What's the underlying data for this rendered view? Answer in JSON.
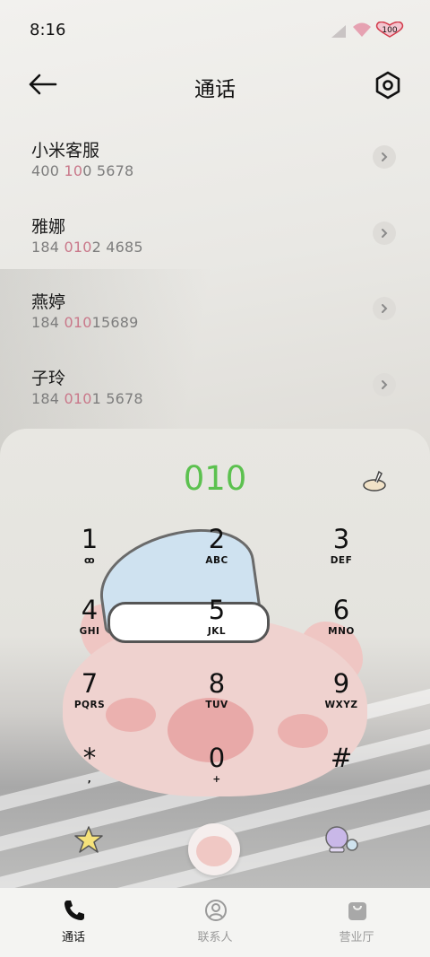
{
  "status_bar": {
    "time": "8:16",
    "battery": "100"
  },
  "header": {
    "title": "通话",
    "back_icon": "arrow-left-icon",
    "settings_icon": "settings-hexagon-icon"
  },
  "contacts": [
    {
      "name": "小米客服",
      "number_parts": [
        "400 ",
        "10",
        "0 5678"
      ]
    },
    {
      "name": "雅娜",
      "number_parts": [
        "184 ",
        "010",
        "2 4685"
      ]
    },
    {
      "name": "燕婷",
      "number_parts": [
        "184 ",
        "010",
        "15689"
      ]
    },
    {
      "name": "子玲",
      "number_parts": [
        "184 ",
        "010",
        "1 5678"
      ]
    }
  ],
  "dialer": {
    "input": "010",
    "keys": [
      {
        "digit": "1",
        "letters": "ꝏ"
      },
      {
        "digit": "2",
        "letters": "ABC"
      },
      {
        "digit": "3",
        "letters": "DEF"
      },
      {
        "digit": "4",
        "letters": "GHI"
      },
      {
        "digit": "5",
        "letters": "JKL"
      },
      {
        "digit": "6",
        "letters": "MNO"
      },
      {
        "digit": "7",
        "letters": "PQRS"
      },
      {
        "digit": "8",
        "letters": "TUV"
      },
      {
        "digit": "9",
        "letters": "WXYZ"
      },
      {
        "digit": "*",
        "letters": ","
      },
      {
        "digit": "0",
        "letters": "+"
      },
      {
        "digit": "#",
        "letters": ""
      }
    ]
  },
  "bottom_nav": [
    {
      "label": "通话",
      "icon": "phone-icon",
      "active": true
    },
    {
      "label": "联系人",
      "icon": "contacts-icon",
      "active": false
    },
    {
      "label": "营业厅",
      "icon": "store-bag-icon",
      "active": false
    }
  ],
  "colors": {
    "accent_green": "#5cc14f",
    "highlight_pink": "#c9788a",
    "battery_red": "#d23a4a"
  }
}
